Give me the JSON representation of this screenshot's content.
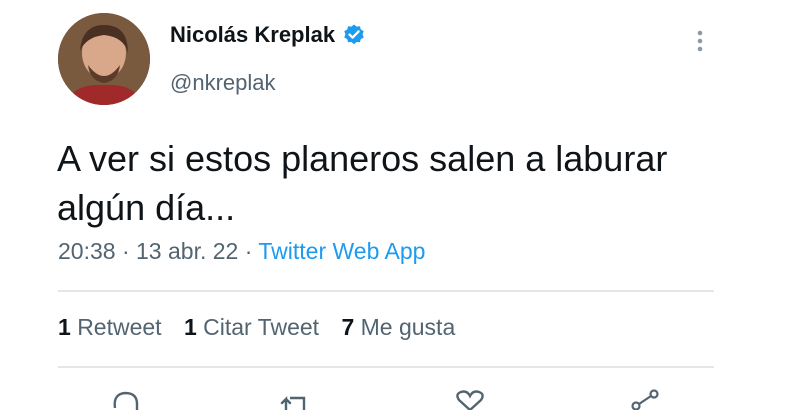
{
  "author": {
    "display_name": "Nicolás Kreplak",
    "handle": "@nkreplak"
  },
  "tweet": {
    "text_line1": "A ver si estos planeros salen a laburar",
    "text_line2": "algún día...",
    "time": "20:38",
    "date": "13 abr. 22",
    "separator": "·",
    "source": "Twitter Web App"
  },
  "stats": {
    "retweets_count": "1",
    "retweets_label": "Retweet",
    "quotes_count": "1",
    "quotes_label": "Citar Tweet",
    "likes_count": "7",
    "likes_label": "Me gusta"
  },
  "colors": {
    "accent": "#1d9bf0",
    "secondary_text": "#536471",
    "primary_text": "#0f1419",
    "divider": "#e3e7ea"
  },
  "icons": {
    "verified": "verified-badge-icon",
    "more": "more-vertical-icon",
    "reply": "reply-icon",
    "retweet": "retweet-icon",
    "like": "heart-icon",
    "share": "share-icon"
  }
}
